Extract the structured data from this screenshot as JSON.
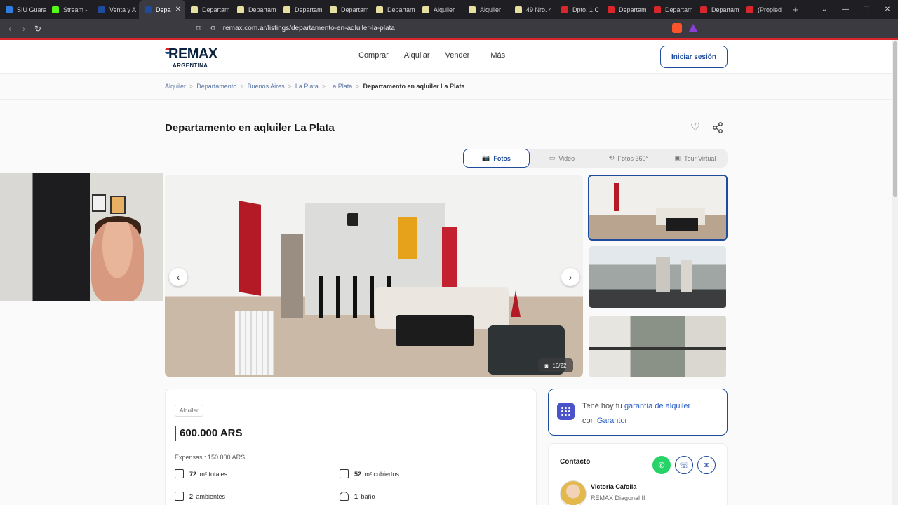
{
  "browser": {
    "tabs": [
      {
        "label": "SIU Guara",
        "color": "#2f7de1"
      },
      {
        "label": "Stream -",
        "color": "#53fc18"
      },
      {
        "label": "Venta y A",
        "color": "#1f4b9c"
      },
      {
        "label": "Depa",
        "color": "#1f4b9c",
        "active": true
      },
      {
        "label": "Departam",
        "color": "#e6dfa0"
      },
      {
        "label": "Departam",
        "color": "#e6dfa0"
      },
      {
        "label": "Departam",
        "color": "#e6dfa0"
      },
      {
        "label": "Departam",
        "color": "#e6dfa0"
      },
      {
        "label": "Departam",
        "color": "#e6dfa0"
      },
      {
        "label": "Alquiler",
        "color": "#e6dfa0"
      },
      {
        "label": "Alquiler",
        "color": "#e6dfa0"
      },
      {
        "label": "49 Nro. 4",
        "color": "#e6dfa0"
      },
      {
        "label": "Dpto. 1 C",
        "color": "#d9262b"
      },
      {
        "label": "Departam",
        "color": "#d9262b"
      },
      {
        "label": "Departam",
        "color": "#d9262b"
      },
      {
        "label": "Departam",
        "color": "#d9262b"
      },
      {
        "label": "(Propied",
        "color": "#d9262b"
      }
    ],
    "url": "remax.com.ar/listings/departamento-en-aqluiler-la-plata"
  },
  "header": {
    "brand": "REMAX",
    "country": "ARGENTINA",
    "nav": [
      "Comprar",
      "Alquilar",
      "Vender",
      "Más"
    ],
    "login": "Iniciar sesión"
  },
  "breadcrumb": {
    "items": [
      "Alquiler",
      "Departamento",
      "Buenos Aires",
      "La Plata",
      "La Plata"
    ],
    "current": "Departamento en aqluiler La Plata"
  },
  "listing": {
    "title": "Departamento en aqluiler La Plata",
    "media_tabs": [
      "Fotos",
      "Video",
      "Fotos 360°",
      "Tour Virtual"
    ],
    "active_media_tab": "Fotos",
    "photo_counter": "16/22",
    "operation": "Alquiler",
    "price": "600.000 ARS",
    "expensas": "Expensas : 150.000 ARS",
    "features": [
      {
        "value": "72",
        "label": "m² totales",
        "icon": "total-area-icon"
      },
      {
        "value": "52",
        "label": "m² cubiertos",
        "icon": "covered-area-icon"
      },
      {
        "value": "2",
        "label": "ambientes",
        "icon": "rooms-icon"
      },
      {
        "value": "1",
        "label": "baño",
        "icon": "bath-icon"
      }
    ]
  },
  "garantor": {
    "line1_prefix": "Tené hoy tu",
    "line1_link": "garantía de alquiler",
    "line2_prefix": "con",
    "line2_link": "Garantor"
  },
  "contact": {
    "title": "Contacto",
    "agent_name": "Victoria Cafolla",
    "agent_office": "REMAX Diagonal II"
  },
  "colors": {
    "brand_blue": "#1f4b9c",
    "brand_red": "#d9262b",
    "whatsapp": "#25d366"
  }
}
